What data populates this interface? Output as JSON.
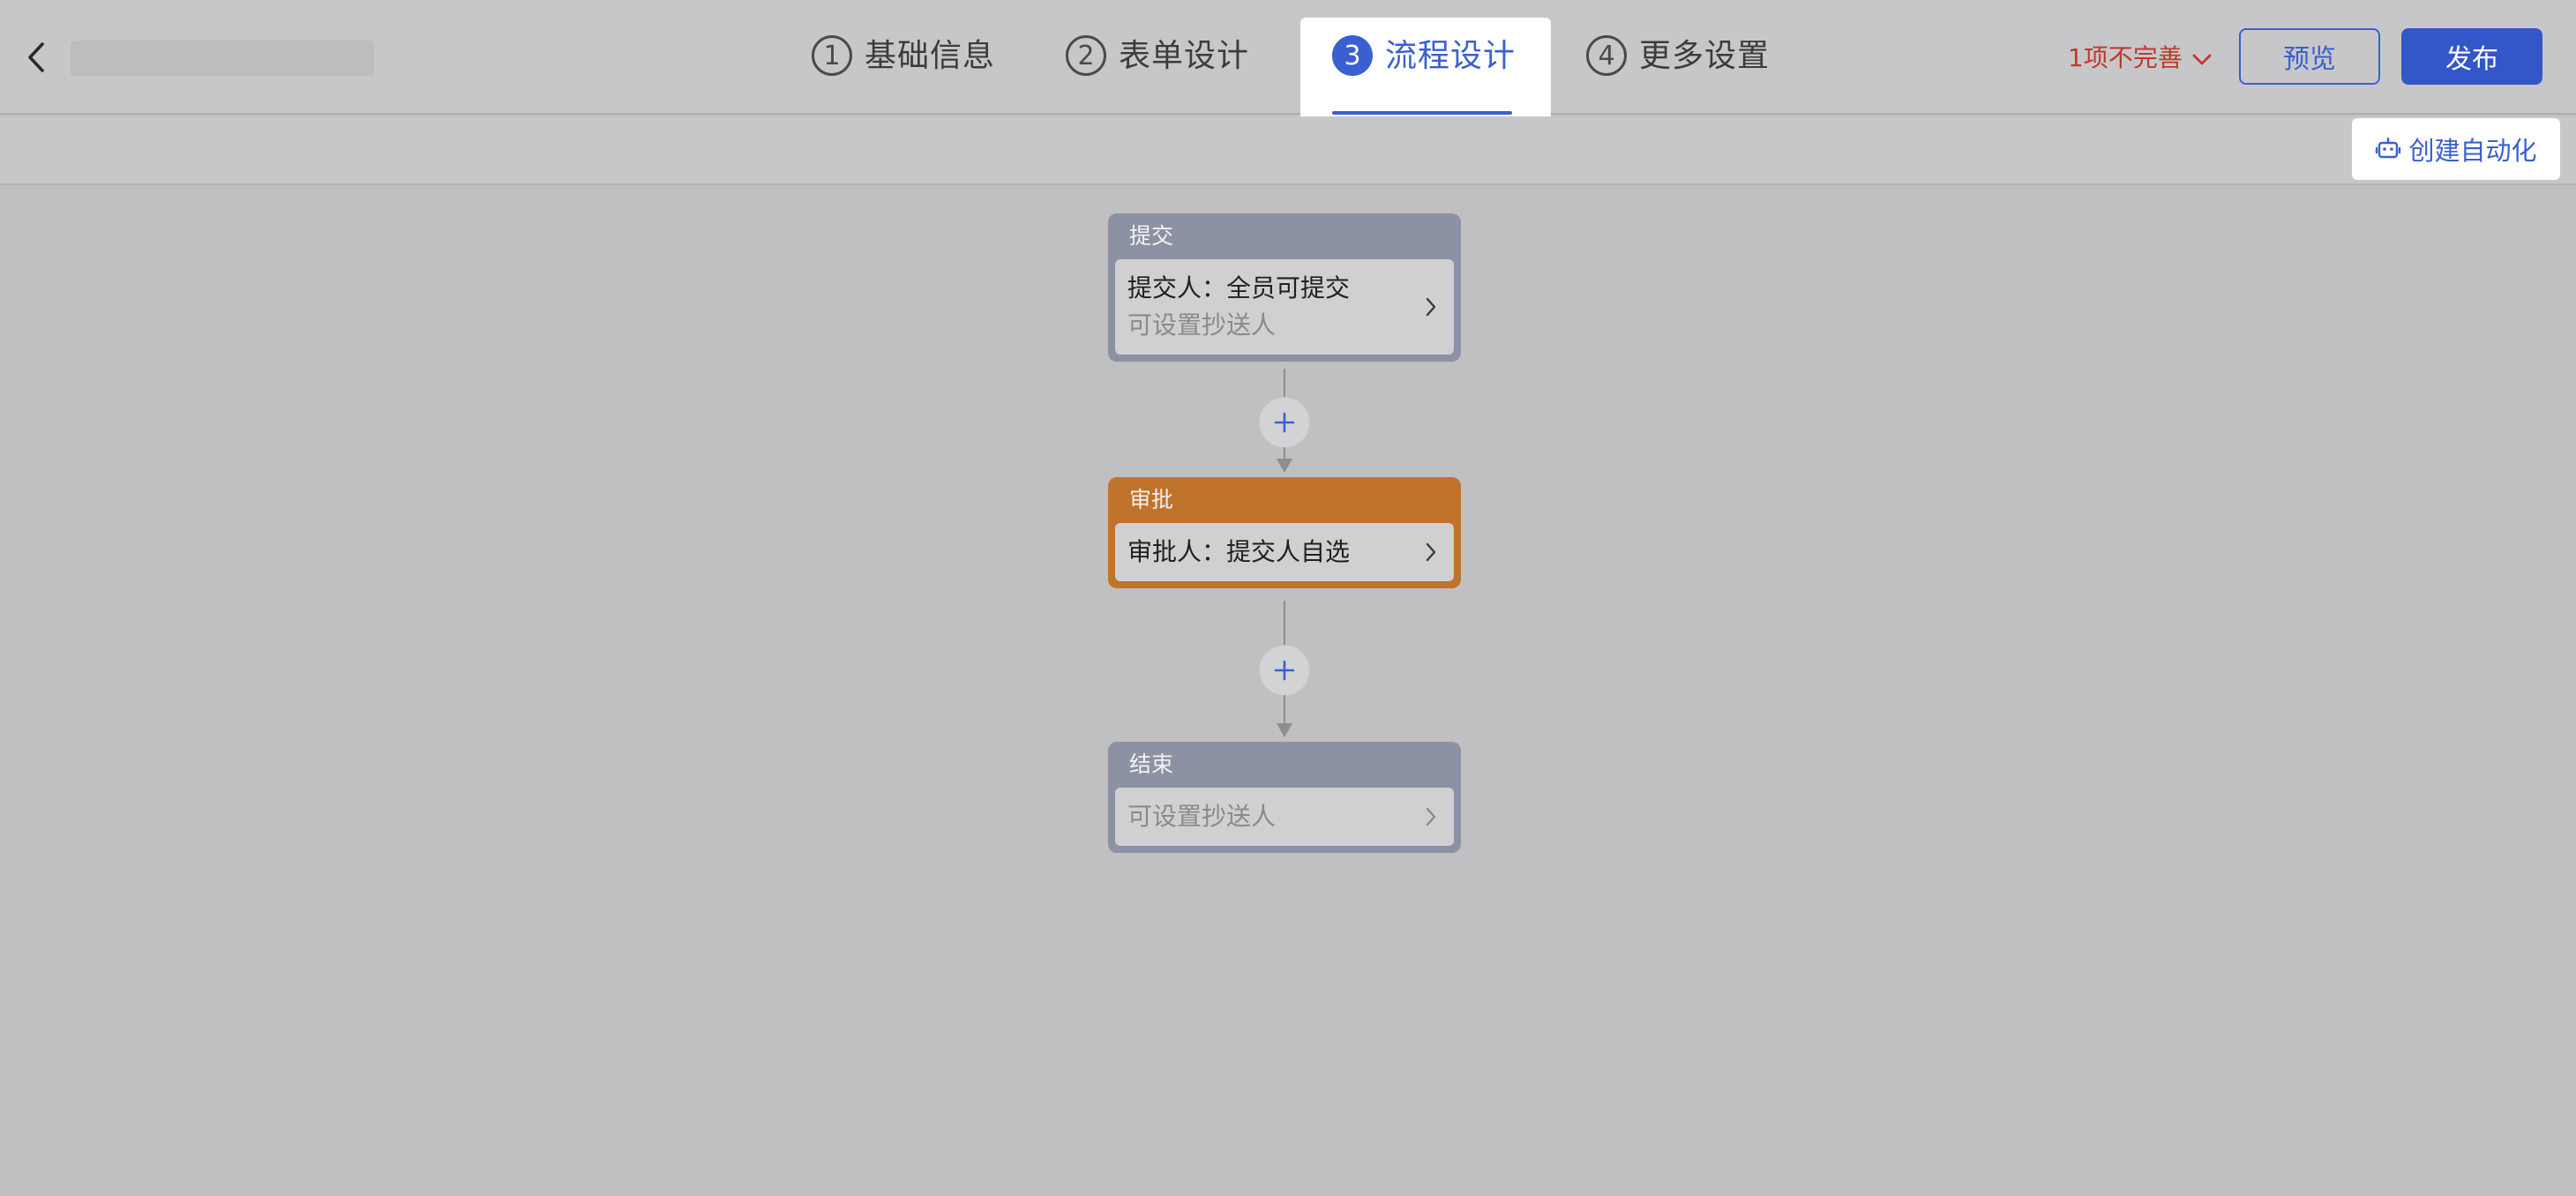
{
  "header": {
    "steps": [
      {
        "num": "1",
        "label": "基础信息"
      },
      {
        "num": "2",
        "label": "表单设计"
      },
      {
        "num": "3",
        "label": "流程设计"
      },
      {
        "num": "4",
        "label": "更多设置"
      }
    ],
    "active_step": "3",
    "incomplete_label": "1项不完善",
    "preview_label": "预览",
    "publish_label": "发布"
  },
  "toolbar": {
    "automation_label": "创建自动化"
  },
  "flow": {
    "nodes": [
      {
        "title": "提交",
        "line1": "提交人：全员可提交",
        "line2": "可设置抄送人",
        "color": "#8c92a3"
      },
      {
        "title": "审批",
        "line1": "审批人：提交人自选",
        "color": "#c0732b"
      },
      {
        "title": "结束",
        "line2": "可设置抄送人",
        "color": "#8c92a3"
      }
    ]
  },
  "colors": {
    "accent": "#3a5fd1",
    "warning": "#c0392b",
    "approval": "#c0732b"
  },
  "icons": {
    "back": "chevron-left-icon",
    "step_num": "circled-number",
    "dropdown": "chevron-down-icon",
    "automation": "robot-icon",
    "node_arrow": "chevron-right-icon",
    "add": "plus-icon"
  }
}
